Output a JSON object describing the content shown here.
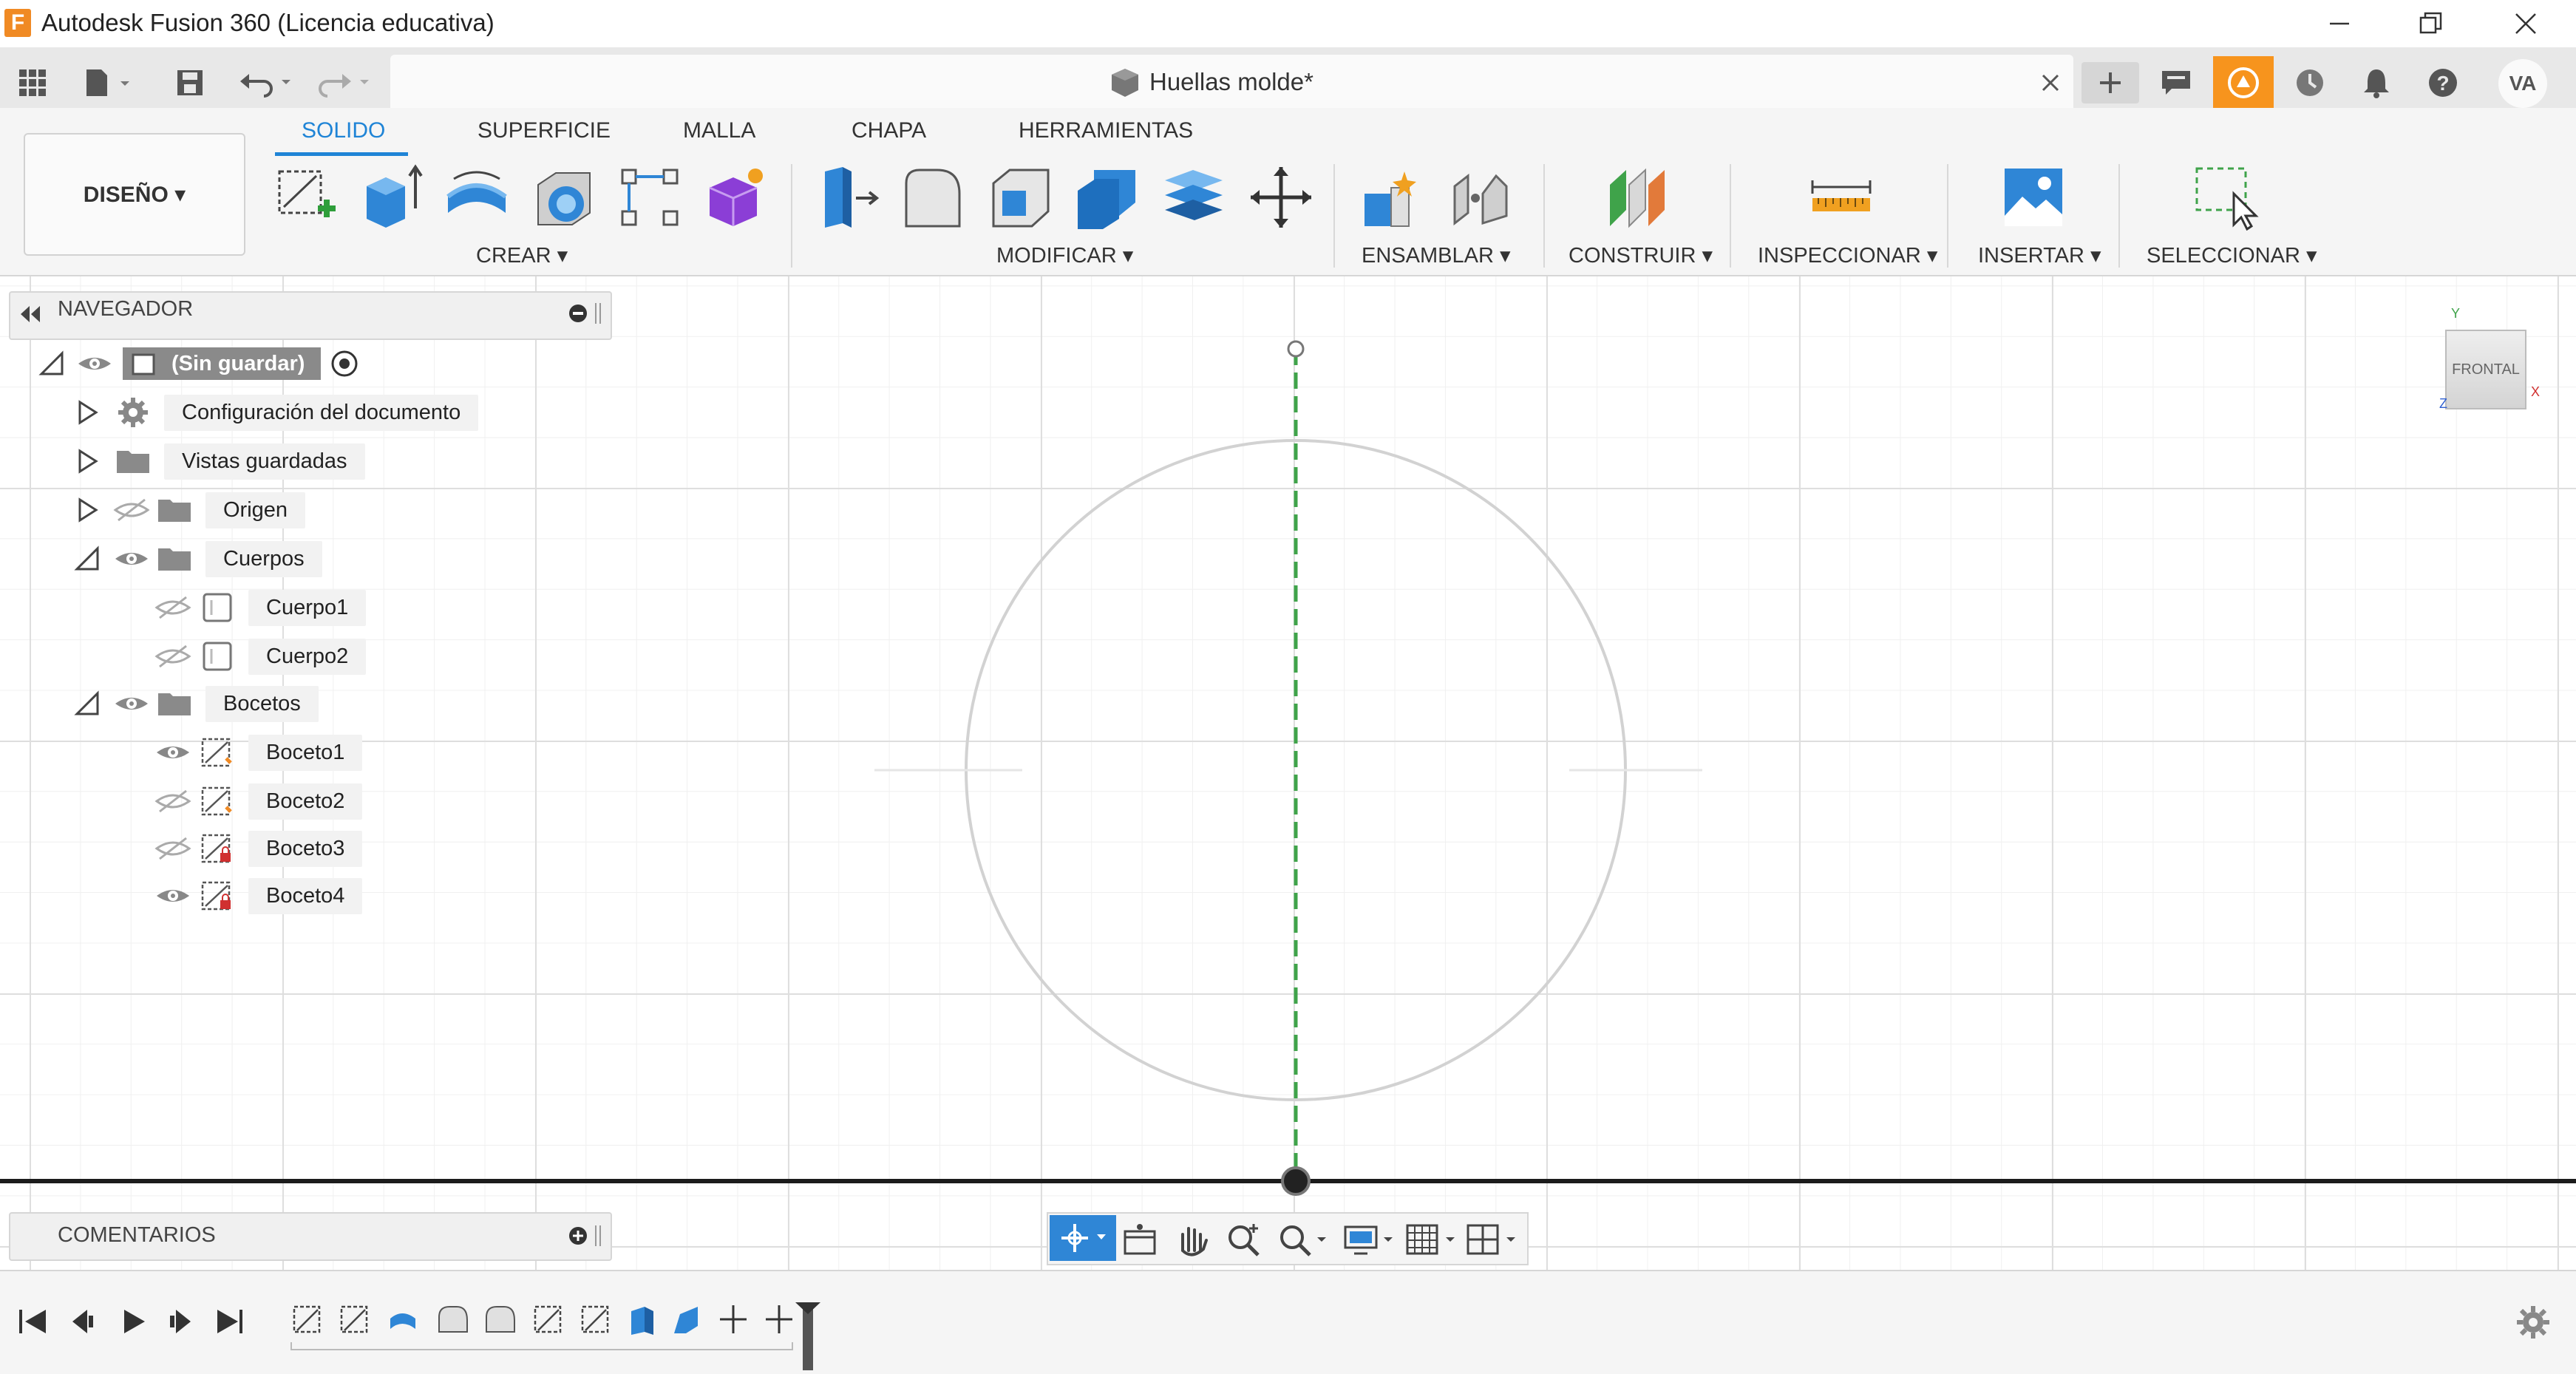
{
  "window": {
    "title": "Autodesk Fusion 360 (Licencia educativa)",
    "app_icon_letter": "F"
  },
  "document": {
    "title": "Huellas molde*"
  },
  "user": {
    "initials": "VA"
  },
  "toolbar": {
    "workspace": "DISEÑO ▾",
    "tabs": [
      "SOLIDO",
      "SUPERFICIE",
      "MALLA",
      "CHAPA",
      "HERRAMIENTAS"
    ],
    "groups": [
      "CREAR ▾",
      "MODIFICAR ▾",
      "ENSAMBLAR ▾",
      "CONSTRUIR ▾",
      "INSPECCIONAR ▾",
      "INSERTAR ▾",
      "SELECCIONAR ▾"
    ]
  },
  "navigator": {
    "title": "NAVEGADOR",
    "root": "(Sin guardar)",
    "items": [
      {
        "label": "Configuración del documento"
      },
      {
        "label": "Vistas guardadas"
      },
      {
        "label": "Origen"
      },
      {
        "label": "Cuerpos"
      },
      {
        "label": "Cuerpo1"
      },
      {
        "label": "Cuerpo2"
      },
      {
        "label": "Bocetos"
      },
      {
        "label": "Boceto1"
      },
      {
        "label": "Boceto2"
      },
      {
        "label": "Boceto3"
      },
      {
        "label": "Boceto4"
      }
    ]
  },
  "comments": {
    "title": "COMENTARIOS"
  },
  "viewcube": {
    "face": "FRONTAL",
    "axis_y": "Y",
    "axis_x": "X",
    "axis_z": "Z"
  },
  "colors": {
    "accent": "#1f84d6",
    "orange": "#f08a24",
    "axis_green": "#2e9e3a"
  },
  "icons": [
    "grid-apps-icon",
    "file-icon",
    "save-icon",
    "undo-icon",
    "redo-icon",
    "close-icon",
    "plus-icon",
    "chat-icon",
    "extension-icon",
    "clock-icon",
    "bell-icon",
    "help-icon",
    "gear-icon"
  ]
}
